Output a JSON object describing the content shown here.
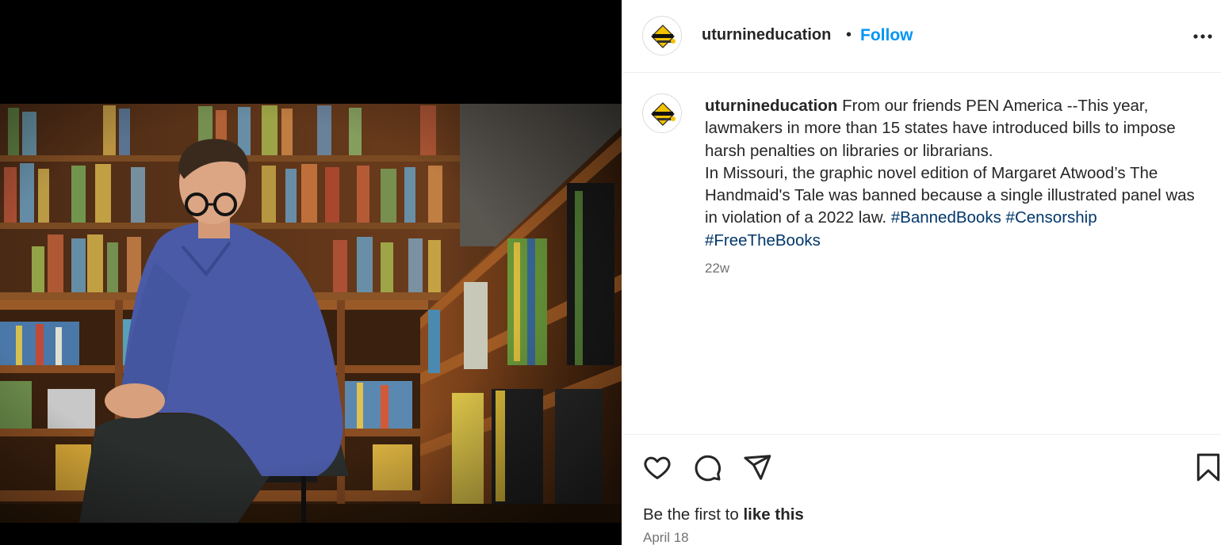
{
  "post": {
    "account": {
      "username": "uturnineducation",
      "follow_label": "Follow",
      "separator": "•"
    },
    "caption": {
      "username": "uturnineducation",
      "text": " From our friends PEN America --This year, lawmakers in more than 15 states have introduced bills to impose harsh penalties on libraries or librarians.",
      "text2": "In Missouri, the graphic novel edition of Margaret Atwood’s The Handmaid's Tale was banned because a single illustrated panel was in violation of a 2022 law. ",
      "hashtags": [
        "#BannedBooks",
        "#Censorship",
        "#FreeTheBooks"
      ],
      "time_ago": "22w"
    },
    "engagement": {
      "likes_prefix": "Be the first to ",
      "likes_link": "like this",
      "date": "April 18"
    },
    "icons": {
      "more": "more-options-icon",
      "like": "heart-icon",
      "comment": "comment-icon",
      "share": "share-icon",
      "save": "bookmark-icon"
    },
    "colors": {
      "link": "#0095f6",
      "hashtag": "#00376b",
      "muted": "#737373"
    }
  }
}
